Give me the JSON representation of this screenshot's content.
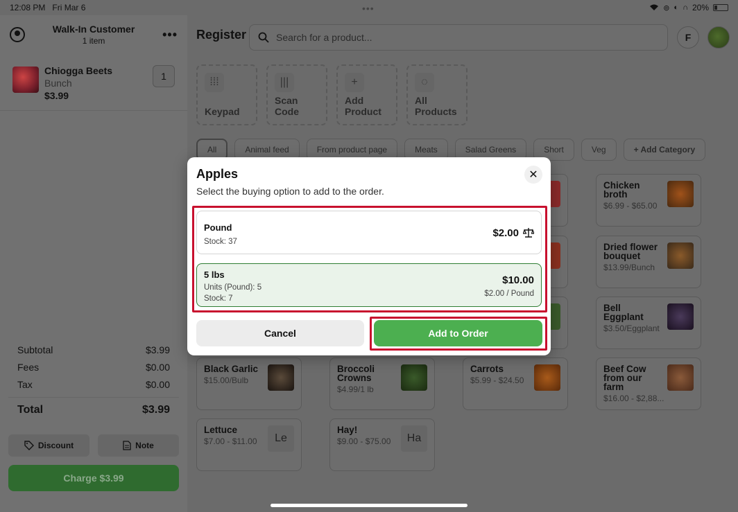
{
  "status_bar": {
    "time": "12:08 PM",
    "date": "Fri Mar 6",
    "battery": "20%",
    "battery_level": 0.2
  },
  "order": {
    "customer": "Walk-In Customer",
    "item_count": "1 item",
    "items": [
      {
        "name": "Chiogga Beets",
        "unit": "Bunch",
        "price": "$3.99",
        "qty": "1"
      }
    ],
    "totals": {
      "subtotal_label": "Subtotal",
      "subtotal": "$3.99",
      "fees_label": "Fees",
      "fees": "$0.00",
      "tax_label": "Tax",
      "tax": "$0.00",
      "total_label": "Total",
      "total": "$3.99"
    },
    "discount_label": "Discount",
    "note_label": "Note",
    "charge_label": "Charge $3.99"
  },
  "register": {
    "title": "Register",
    "search_placeholder": "Search for a product...",
    "flag_label": "F",
    "quick_actions": [
      {
        "label": "Keypad",
        "icon": "keypad-icon"
      },
      {
        "label": "Scan Code",
        "icon": "barcode-icon"
      },
      {
        "label": "Add Product",
        "icon": "plus-icon"
      },
      {
        "label": "All Products",
        "icon": "apple-icon"
      }
    ],
    "categories": [
      "All",
      "Animal feed",
      "From product page",
      "Meats",
      "Salad Greens",
      "Short",
      "Veg"
    ],
    "add_category_label": "+ Add Category",
    "products": [
      {
        "name": "Chicken broth",
        "price": "$6.99 - $65.00"
      },
      {
        "name": "Dried flower bouquet",
        "price": "$13.99/Bunch"
      },
      {
        "name": "Bell Eggplant",
        "price": "$3.50/Eggplant"
      },
      {
        "name": "Black Garlic",
        "price": "$15.00/Bulb"
      },
      {
        "name": "Broccoli Crowns",
        "price": "$4.99/1 lb"
      },
      {
        "name": "Carrots",
        "price": "$5.99 - $24.50"
      },
      {
        "name": "Beef Cow from our farm",
        "price": "$16.00 - $2,88..."
      },
      {
        "name": "Lettuce",
        "price": "$7.00 - $11.00",
        "initials": "Le"
      },
      {
        "name": "Hay!",
        "price": "$9.00 - $75.00",
        "initials": "Ha"
      }
    ]
  },
  "modal": {
    "title": "Apples",
    "subtitle": "Select the buying option to add to the order.",
    "options": [
      {
        "name": "Pound",
        "stock": "Stock: 37",
        "price": "$2.00",
        "icon": "scale-icon"
      },
      {
        "name": "5 lbs",
        "units": "Units (Pound): 5",
        "stock": "Stock: 7",
        "price": "$10.00",
        "unit_price": "$2.00 / Pound"
      }
    ],
    "cancel_label": "Cancel",
    "add_label": "Add to Order"
  },
  "colors": {
    "accent_green": "#4caf50",
    "highlight_red": "#c8102e"
  }
}
